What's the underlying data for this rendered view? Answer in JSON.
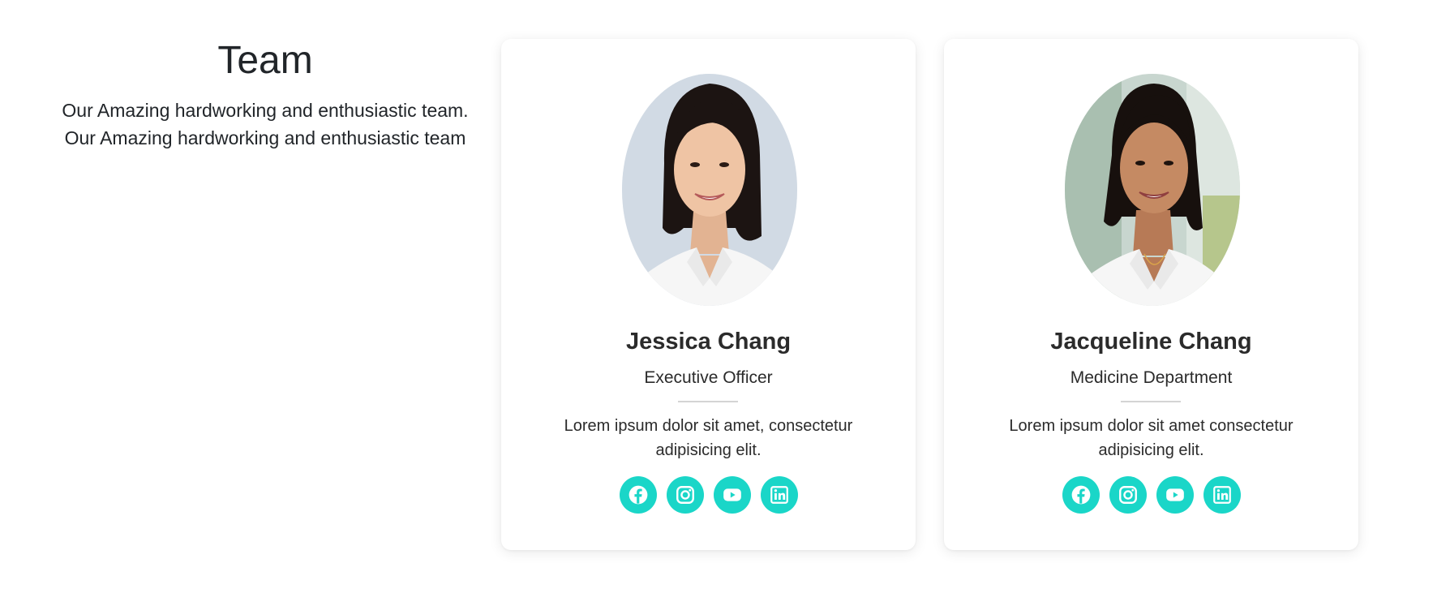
{
  "team": {
    "title": "Team",
    "line1": "Our Amazing hardworking and enthusiastic team.",
    "line2": "Our Amazing hardworking and enthusiastic team"
  },
  "members": [
    {
      "name": "Jessica Chang",
      "role": "Executive Officer",
      "desc_line1": "Lorem ipsum dolor sit amet, consectetur",
      "desc_line2": "adipisicing elit.",
      "photo_icon": "portrait-photo"
    },
    {
      "name": "Jacqueline Chang",
      "role": "Medicine Department",
      "desc_line1": "Lorem ipsum dolor sit amet consectetur",
      "desc_line2": "adipisicing elit.",
      "photo_icon": "portrait-photo"
    }
  ],
  "social_icons": [
    "facebook-icon",
    "instagram-icon",
    "youtube-icon",
    "linkedin-icon"
  ],
  "colors": {
    "accent": "#1ad6c8",
    "text": "#212529",
    "card_bg": "#ffffff"
  }
}
